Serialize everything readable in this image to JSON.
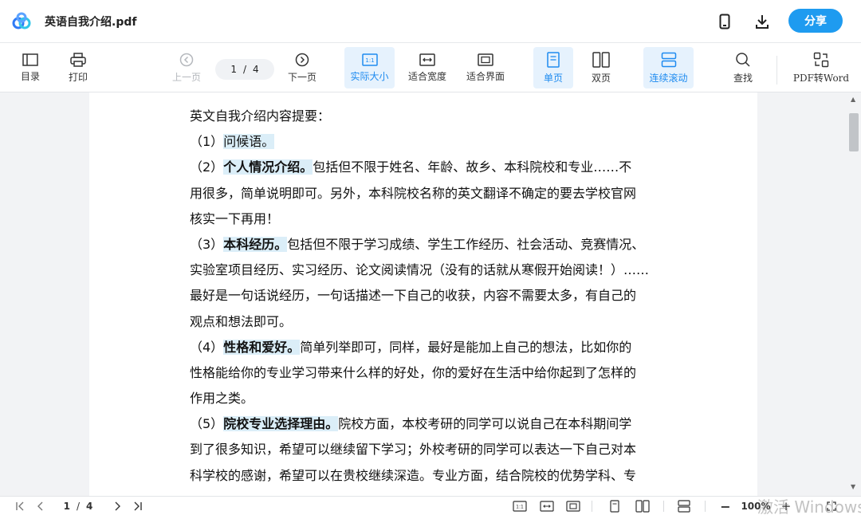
{
  "app": {
    "title": "英语自我介绍.pdf",
    "share_label": "分享"
  },
  "toolbar": {
    "toc": "目录",
    "print": "打印",
    "prev": "上一页",
    "page_current": "1",
    "page_sep": "/",
    "page_total": "4",
    "next": "下一页",
    "actual_size": "实际大小",
    "fit_width": "适合宽度",
    "fit_page": "适合界面",
    "single": "单页",
    "double": "双页",
    "continuous": "连续滚动",
    "find": "查找",
    "pdf_to_word": "PDF转Word"
  },
  "document": {
    "lines": [
      [
        {
          "t": "英文自我介绍内容提要："
        }
      ],
      [
        {
          "t": "（1）"
        },
        {
          "t": "问候语。",
          "h": "hl2"
        }
      ],
      [
        {
          "t": "（2）"
        },
        {
          "t": "个人情况介绍。",
          "h": "hl"
        },
        {
          "t": "包括但不限于姓名、年龄、故乡、本科院校和专业……不"
        }
      ],
      [
        {
          "t": "用很多，简单说明即可。另外，本科院校名称的英文翻译不确定的要去学校官网"
        }
      ],
      [
        {
          "t": "核实一下再用！"
        }
      ],
      [
        {
          "t": "（3）"
        },
        {
          "t": "本科经历。",
          "h": "hl"
        },
        {
          "t": "包括但不限于学习成绩、学生工作经历、社会活动、竞赛情况、"
        }
      ],
      [
        {
          "t": "实验室项目经历、实习经历、论文阅读情况（没有的话就从寒假开始阅读！）……"
        }
      ],
      [
        {
          "t": "最好是一句话说经历，一句话描述一下自己的收获，内容不需要太多，有自己的"
        }
      ],
      [
        {
          "t": "观点和想法即可。"
        }
      ],
      [
        {
          "t": "（4）"
        },
        {
          "t": "性格和爱好。",
          "h": "hl"
        },
        {
          "t": "简单列举即可，同样，最好是能加上自己的想法，比如你的"
        }
      ],
      [
        {
          "t": "性格能给你的专业学习带来什么样的好处，你的爱好在生活中给你起到了怎样的"
        }
      ],
      [
        {
          "t": "作用之类。"
        }
      ],
      [
        {
          "t": "（5）"
        },
        {
          "t": "院校专业选择理由。",
          "h": "hl"
        },
        {
          "t": "院校方面，本校考研的同学可以说自己在本科期间学"
        }
      ],
      [
        {
          "t": "到了很多知识，希望可以继续留下学习；外校考研的同学可以表达一下自己对本"
        }
      ],
      [
        {
          "t": "科学校的感谢，希望可以在贵校继续深造。专业方面，结合院校的优势学科、专"
        }
      ]
    ]
  },
  "statusbar": {
    "page_current": "1",
    "page_sep": "/",
    "page_total": "4",
    "zoom": "100%"
  },
  "watermark": "激活 Windows",
  "colors": {
    "accent": "#1e9bf0",
    "highlight": "#dbeef8"
  }
}
